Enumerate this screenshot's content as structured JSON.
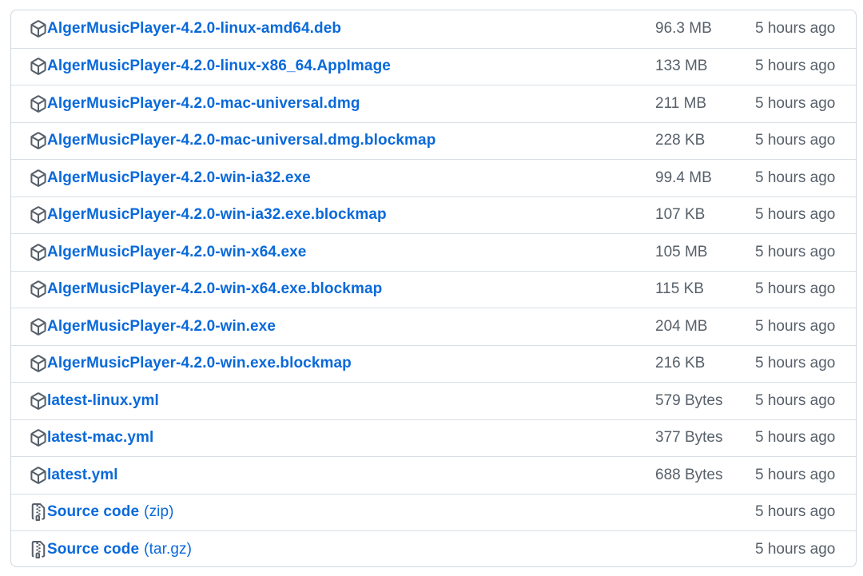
{
  "assets": [
    {
      "name": "AlgerMusicPlayer-4.2.0-linux-amd64.deb",
      "size": "96.3 MB",
      "time": "5 hours ago",
      "icon": "package-icon"
    },
    {
      "name": "AlgerMusicPlayer-4.2.0-linux-x86_64.AppImage",
      "size": "133 MB",
      "time": "5 hours ago",
      "icon": "package-icon"
    },
    {
      "name": "AlgerMusicPlayer-4.2.0-mac-universal.dmg",
      "size": "211 MB",
      "time": "5 hours ago",
      "icon": "package-icon"
    },
    {
      "name": "AlgerMusicPlayer-4.2.0-mac-universal.dmg.blockmap",
      "size": "228 KB",
      "time": "5 hours ago",
      "icon": "package-icon"
    },
    {
      "name": "AlgerMusicPlayer-4.2.0-win-ia32.exe",
      "size": "99.4 MB",
      "time": "5 hours ago",
      "icon": "package-icon"
    },
    {
      "name": "AlgerMusicPlayer-4.2.0-win-ia32.exe.blockmap",
      "size": "107 KB",
      "time": "5 hours ago",
      "icon": "package-icon"
    },
    {
      "name": "AlgerMusicPlayer-4.2.0-win-x64.exe",
      "size": "105 MB",
      "time": "5 hours ago",
      "icon": "package-icon"
    },
    {
      "name": "AlgerMusicPlayer-4.2.0-win-x64.exe.blockmap",
      "size": "115 KB",
      "time": "5 hours ago",
      "icon": "package-icon"
    },
    {
      "name": "AlgerMusicPlayer-4.2.0-win.exe",
      "size": "204 MB",
      "time": "5 hours ago",
      "icon": "package-icon"
    },
    {
      "name": "AlgerMusicPlayer-4.2.0-win.exe.blockmap",
      "size": "216 KB",
      "time": "5 hours ago",
      "icon": "package-icon"
    },
    {
      "name": "latest-linux.yml",
      "size": "579 Bytes",
      "time": "5 hours ago",
      "icon": "package-icon"
    },
    {
      "name": "latest-mac.yml",
      "size": "377 Bytes",
      "time": "5 hours ago",
      "icon": "package-icon"
    },
    {
      "name": "latest.yml",
      "size": "688 Bytes",
      "time": "5 hours ago",
      "icon": "package-icon"
    },
    {
      "name": "Source code",
      "suffix": "(zip)",
      "size": "",
      "time": "5 hours ago",
      "icon": "file-zip-icon"
    },
    {
      "name": "Source code",
      "suffix": "(tar.gz)",
      "size": "",
      "time": "5 hours ago",
      "icon": "file-zip-icon"
    }
  ],
  "colors": {
    "link": "#0969da",
    "muted": "#57606a",
    "border": "#d0d7de"
  }
}
